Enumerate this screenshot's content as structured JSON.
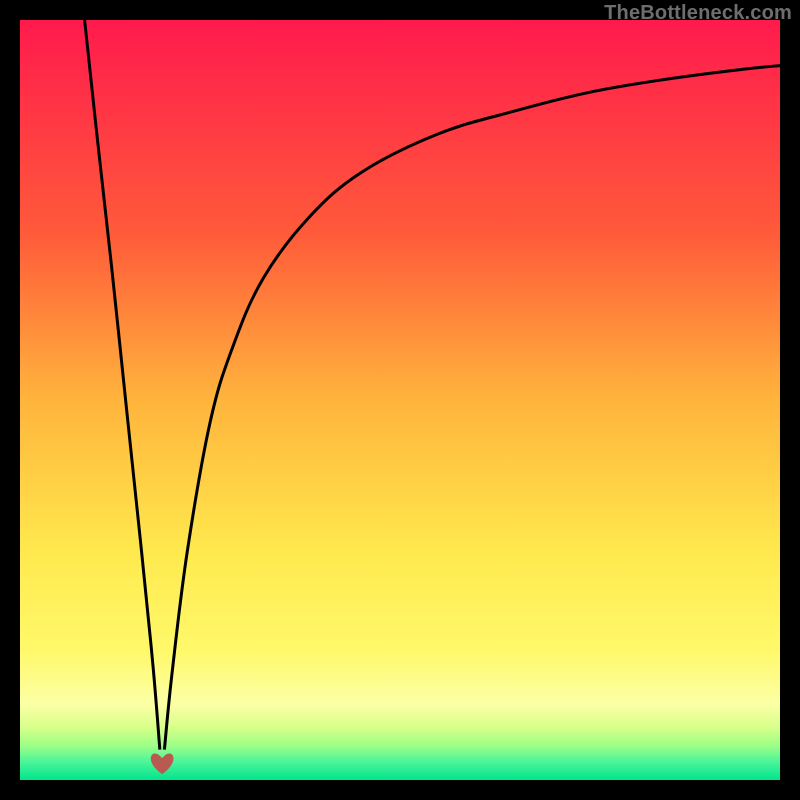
{
  "watermark": "TheBottleneck.com",
  "colors": {
    "frame": "#000000",
    "watermark": "#6e6e6e",
    "gradient_stops": [
      {
        "offset": 0.0,
        "color": "#ff1a4d"
      },
      {
        "offset": 0.28,
        "color": "#ff5a3a"
      },
      {
        "offset": 0.5,
        "color": "#ffb43c"
      },
      {
        "offset": 0.7,
        "color": "#ffe94e"
      },
      {
        "offset": 0.83,
        "color": "#fff96a"
      },
      {
        "offset": 0.9,
        "color": "#fcffa6"
      },
      {
        "offset": 0.93,
        "color": "#d8ff8a"
      },
      {
        "offset": 0.955,
        "color": "#9dff86"
      },
      {
        "offset": 0.975,
        "color": "#50f59a"
      },
      {
        "offset": 1.0,
        "color": "#00e58c"
      }
    ],
    "curve": "#000000",
    "heart": "#b85a4f"
  },
  "chart_data": {
    "type": "line",
    "title": "",
    "xlabel": "",
    "ylabel": "",
    "xlim": [
      0,
      100
    ],
    "ylim": [
      0,
      100
    ],
    "legend": false,
    "annotations": [
      {
        "kind": "heart-marker",
        "x": 18.7,
        "y": 2.0
      }
    ],
    "series": [
      {
        "name": "left-branch",
        "x": [
          8.5,
          10,
          12,
          14,
          16,
          17.5,
          18.4
        ],
        "y": [
          100,
          86,
          68,
          49,
          30,
          15,
          4
        ]
      },
      {
        "name": "right-branch",
        "x": [
          19.0,
          20,
          22,
          25,
          28,
          32,
          38,
          45,
          55,
          65,
          75,
          85,
          95,
          100
        ],
        "y": [
          4,
          14,
          30,
          47,
          57,
          66,
          74,
          80,
          85,
          88,
          90.5,
          92.2,
          93.5,
          94
        ]
      }
    ]
  }
}
